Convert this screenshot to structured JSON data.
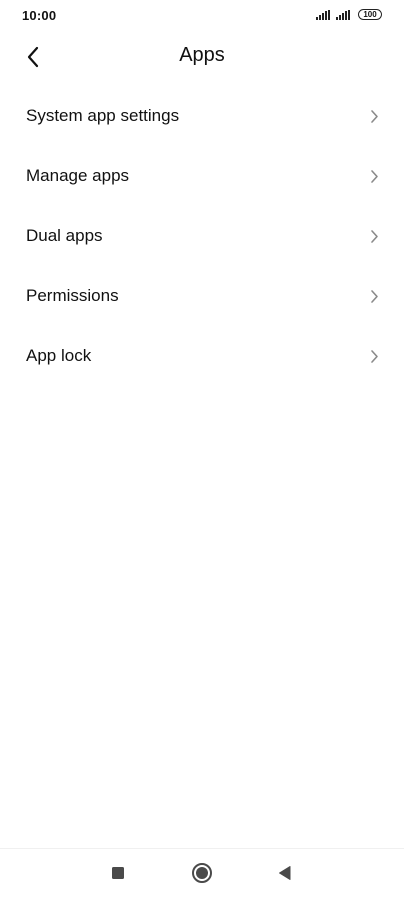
{
  "status_bar": {
    "time": "10:00",
    "battery": "100",
    "icons": [
      "signal-icon",
      "signal-icon",
      "battery-icon"
    ]
  },
  "header": {
    "title": "Apps",
    "back_icon": "back-arrow-icon"
  },
  "list": {
    "items": [
      {
        "label": "System app settings",
        "icon": "chevron-right-icon"
      },
      {
        "label": "Manage apps",
        "icon": "chevron-right-icon"
      },
      {
        "label": "Dual apps",
        "icon": "chevron-right-icon"
      },
      {
        "label": "Permissions",
        "icon": "chevron-right-icon"
      },
      {
        "label": "App lock",
        "icon": "chevron-right-icon"
      }
    ]
  },
  "nav_bar": {
    "buttons": [
      "recents-icon",
      "home-icon",
      "back-triangle-icon"
    ]
  },
  "colors": {
    "text": "#111111",
    "chevron": "#8a8a8a",
    "background": "#ffffff",
    "nav_icon": "#4a4a4a"
  }
}
